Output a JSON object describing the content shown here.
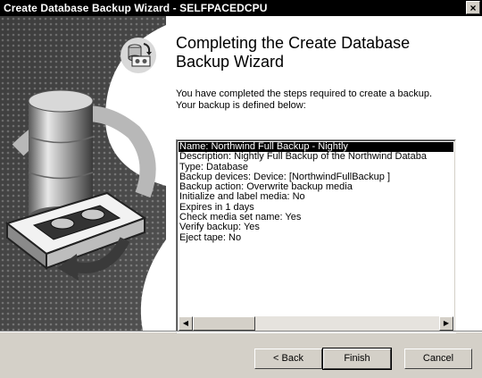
{
  "window": {
    "title": "Create Database Backup Wizard - SELFPACEDCPU",
    "close_glyph": "×"
  },
  "page": {
    "heading_line1": "Completing the Create Database",
    "heading_line2": "Backup Wizard",
    "intro_line1": "You have completed the steps required to create a backup.",
    "intro_line2": "Your backup is defined below:"
  },
  "summary": {
    "lines": [
      "Name:   Northwind Full Backup - Nightly",
      "Description:   Nightly Full Backup of the Northwind Databa",
      "Type:   Database",
      "Backup devices:    Device: [NorthwindFullBackup ]",
      "Backup action:   Overwrite backup media",
      "Initialize and label media:   No",
      "Expires in 1 days",
      "Check media set name:   Yes",
      "Verify backup:   Yes",
      "Eject tape:   No"
    ],
    "selected_index": 0,
    "scroll_left_glyph": "◀",
    "scroll_right_glyph": "▶"
  },
  "buttons": {
    "back": "< Back",
    "finish": "Finish",
    "cancel": "Cancel"
  },
  "icons": {
    "wizard_icon": "database-backup-icon",
    "art": "database-tape-illustration"
  }
}
